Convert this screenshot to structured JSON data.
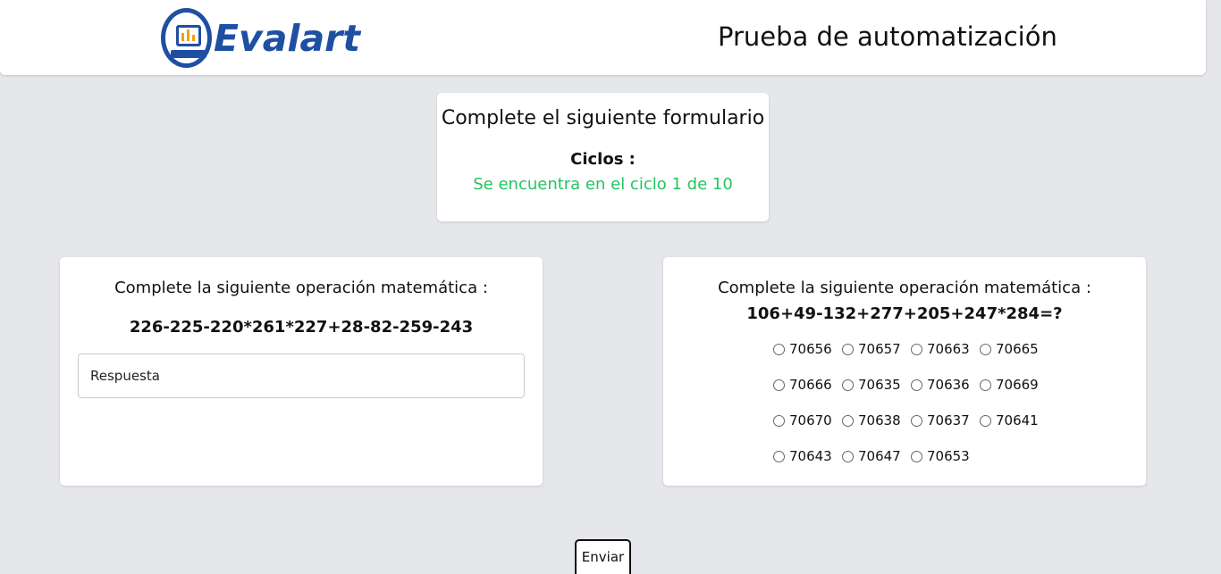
{
  "header": {
    "logo_text": "Evalart",
    "title": "Prueba de automatización"
  },
  "form_header": {
    "title": "Complete el siguiente formulario",
    "cycles_label": "Ciclos :",
    "cycles_status": "Se encuentra en el ciclo 1 de 10",
    "status_color": "#22c55e"
  },
  "left_question": {
    "title": "Complete la siguiente operación matemática :",
    "expression": "226-225-220*261*227+28-82-259-243",
    "input_placeholder": "Respuesta",
    "input_value": ""
  },
  "right_question": {
    "title": "Complete la siguiente operación matemática :",
    "expression": "106+49-132+277+205+247*284=?",
    "options": [
      "70656",
      "70657",
      "70663",
      "70665",
      "70666",
      "70635",
      "70636",
      "70669",
      "70670",
      "70638",
      "70637",
      "70641",
      "70643",
      "70647",
      "70653"
    ]
  },
  "submit": {
    "label": "Enviar"
  },
  "colors": {
    "brand": "#1e4fa3",
    "accent": "#f59e0b",
    "background": "#e5e7eb"
  }
}
